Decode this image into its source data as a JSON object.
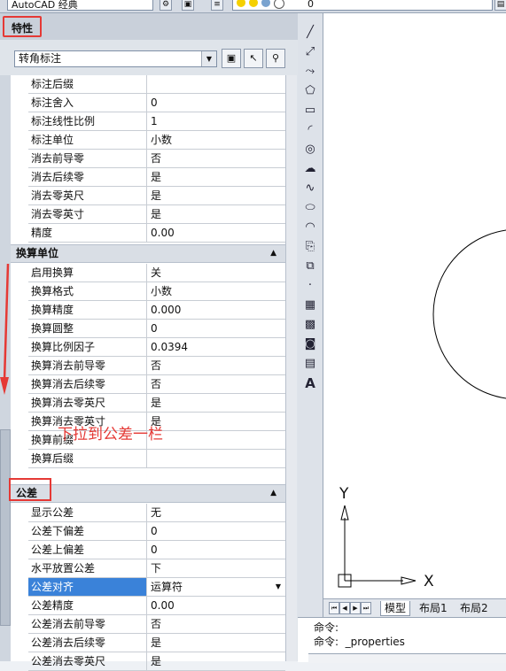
{
  "toolbar": {
    "workspace": "AutoCAD 经典",
    "layer_value": "0"
  },
  "palette": {
    "title": "特性",
    "object_type": "转角标注",
    "rows_top": [
      {
        "k": "标注后缀",
        "v": ""
      },
      {
        "k": "标注舍入",
        "v": "0"
      },
      {
        "k": "标注线性比例",
        "v": "1"
      },
      {
        "k": "标注单位",
        "v": "小数"
      },
      {
        "k": "消去前导零",
        "v": "否"
      },
      {
        "k": "消去后续零",
        "v": "是"
      },
      {
        "k": "消去零英尺",
        "v": "是"
      },
      {
        "k": "消去零英寸",
        "v": "是"
      },
      {
        "k": "精度",
        "v": "0.00"
      }
    ],
    "section_alt": "换算单位",
    "rows_alt": [
      {
        "k": "启用换算",
        "v": "关"
      },
      {
        "k": "换算格式",
        "v": "小数"
      },
      {
        "k": "换算精度",
        "v": "0.000"
      },
      {
        "k": "换算圆整",
        "v": "0"
      },
      {
        "k": "换算比例因子",
        "v": "0.0394"
      },
      {
        "k": "换算消去前导零",
        "v": "否"
      },
      {
        "k": "换算消去后续零",
        "v": "否"
      },
      {
        "k": "换算消去零英尺",
        "v": "是"
      },
      {
        "k": "换算消去零英寸",
        "v": "是"
      },
      {
        "k": "换算前缀",
        "v": ""
      },
      {
        "k": "换算后缀",
        "v": ""
      }
    ],
    "section_tol": "公差",
    "rows_tol": [
      {
        "k": "显示公差",
        "v": "无"
      },
      {
        "k": "公差下偏差",
        "v": "0"
      },
      {
        "k": "公差上偏差",
        "v": "0"
      },
      {
        "k": "水平放置公差",
        "v": "下"
      },
      {
        "k": "公差对齐",
        "v": "运算符"
      },
      {
        "k": "公差精度",
        "v": "0.00"
      },
      {
        "k": "公差消去前导零",
        "v": "否"
      },
      {
        "k": "公差消去后续零",
        "v": "是"
      },
      {
        "k": "公差消去零英尺",
        "v": "是"
      }
    ],
    "annotation": "下拉到公差一栏"
  },
  "drawing": {
    "axis_y": "Y",
    "axis_x": "X"
  },
  "tabs": {
    "model": "模型",
    "layout1": "布局1",
    "layout2": "布局2"
  },
  "command": {
    "line1": "命令:",
    "line2": "命令:  _properties"
  },
  "colors": {
    "highlight_red": "#e53935",
    "selected_blue": "#3a82d9"
  }
}
